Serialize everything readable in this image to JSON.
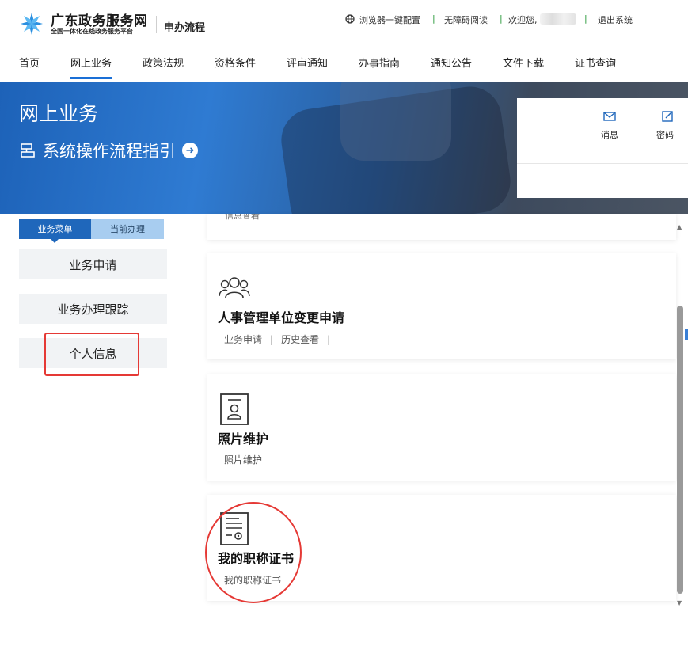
{
  "header": {
    "brand_name": "广东政务服务网",
    "brand_sub": "全国一体化在线政务服务平台",
    "brand_flow": "申办流程",
    "browser_config": "浏览器一键配置",
    "accessibility": "无障碍阅读",
    "welcome": "欢迎您,",
    "logout": "退出系统",
    "separator": "|"
  },
  "nav": {
    "items": [
      "首页",
      "网上业务",
      "政策法规",
      "资格条件",
      "评审通知",
      "办事指南",
      "通知公告",
      "文件下载",
      "证书查询"
    ],
    "active_index": 1
  },
  "banner": {
    "title": "网上业务",
    "guide": "系统操作流程指引",
    "panel_items": [
      "消息",
      "密码"
    ]
  },
  "sidebar": {
    "tabs": [
      "业务菜单",
      "当前办理"
    ],
    "items": [
      "业务申请",
      "业务办理跟踪",
      "个人信息"
    ]
  },
  "cards": [
    {
      "links": [
        "信息查看"
      ]
    },
    {
      "title": "人事管理单位变更申请",
      "links": [
        "业务申请",
        "历史查看"
      ]
    },
    {
      "title": "照片维护",
      "links": [
        "照片维护"
      ]
    },
    {
      "title": "我的职称证书",
      "links": [
        "我的职称证书"
      ]
    }
  ],
  "colors": {
    "primary": "#1f67bb",
    "highlight_red": "#e53935",
    "tab_inactive": "#a8cdf0"
  }
}
